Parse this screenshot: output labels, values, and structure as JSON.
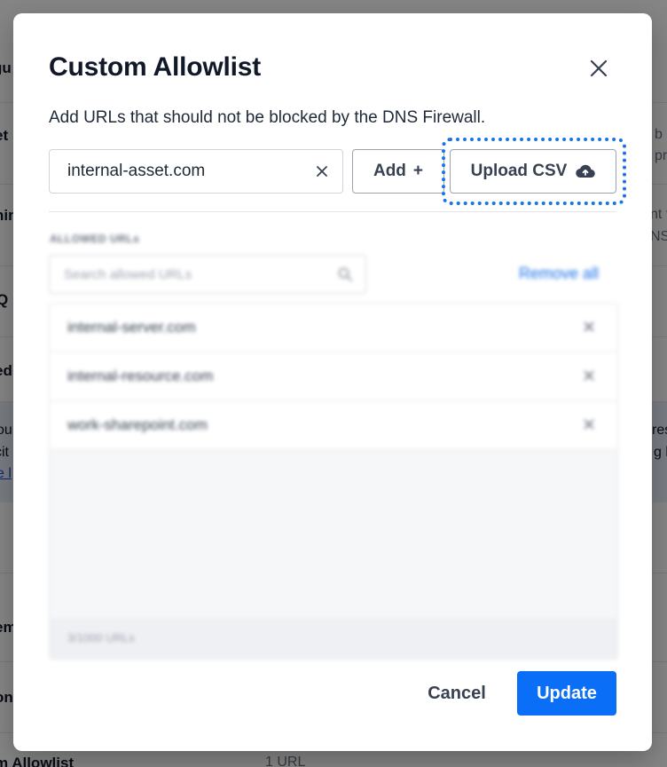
{
  "background": {
    "left_fragments": [
      "gu",
      "et",
      "nim",
      "Q",
      "ed",
      "ou",
      "cit",
      "e l",
      "em",
      "on",
      "m Allowlist"
    ],
    "right_fragments": [
      "b",
      "pr",
      "nt f",
      "NS",
      "res",
      "g l"
    ],
    "bottom_value": "1 URL"
  },
  "modal": {
    "title": "Custom Allowlist",
    "subtitle": "Add URLs that should not be blocked by the DNS Firewall.",
    "url_input_value": "internal-asset.com",
    "add_label": "Add",
    "add_symbol": "+",
    "upload_label": "Upload CSV",
    "allowed_urls_label": "ALLOWED URLs",
    "search_placeholder": "Search allowed URLs",
    "remove_all_label": "Remove all",
    "allowed_urls": [
      {
        "label": "internal-server.com"
      },
      {
        "label": "internal-resource.com"
      },
      {
        "label": "work-sharepoint.com"
      }
    ],
    "url_count": "3/1000 URLs",
    "cancel_label": "Cancel",
    "update_label": "Update"
  },
  "colors": {
    "accent": "#0b6ef6",
    "focus_ring": "#1a73e8",
    "overlay": "rgba(0,0,0,0.48)"
  },
  "icons": {
    "close": "close-icon",
    "clear": "clear-input-icon",
    "upload": "cloud-upload-icon",
    "search": "search-icon",
    "remove_item": "remove-item-icon"
  }
}
